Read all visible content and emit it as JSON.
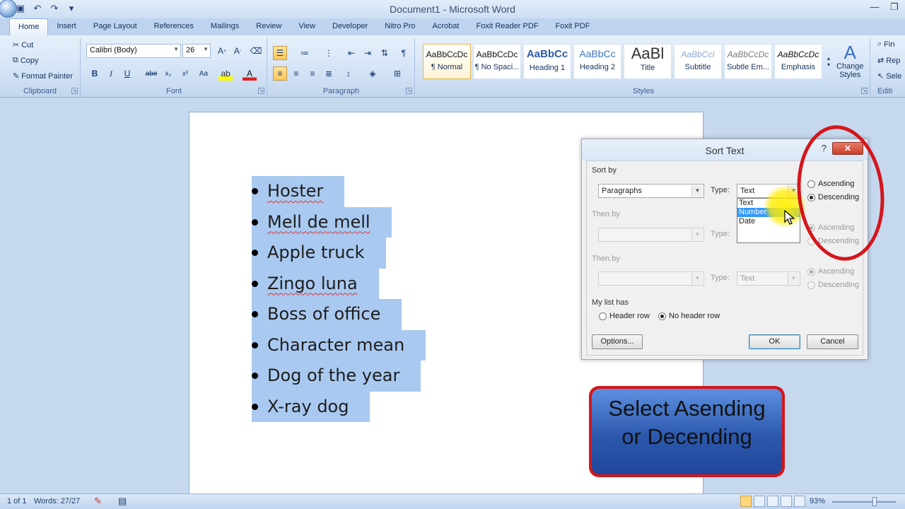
{
  "window": {
    "title": "Document1 - Microsoft Word"
  },
  "tabs": [
    "Home",
    "Insert",
    "Page Layout",
    "References",
    "Mailings",
    "Review",
    "View",
    "Developer",
    "Nitro Pro",
    "Acrobat",
    "Foxit Reader PDF",
    "Foxit PDF"
  ],
  "ribbon": {
    "clipboard": {
      "label": "Clipboard",
      "cut": "Cut",
      "copy": "Copy",
      "format_painter": "Format Painter"
    },
    "font": {
      "label": "Font",
      "font_name": "Calibri (Body)",
      "font_size": "26"
    },
    "paragraph": {
      "label": "Paragraph"
    },
    "styles": {
      "label": "Styles",
      "items": [
        {
          "preview": "AaBbCcDc",
          "name": "¶ Normal"
        },
        {
          "preview": "AaBbCcDc",
          "name": "¶ No Spaci..."
        },
        {
          "preview": "AaBbCc",
          "name": "Heading 1"
        },
        {
          "preview": "AaBbCc",
          "name": "Heading 2"
        },
        {
          "preview": "AaBl",
          "name": "Title"
        },
        {
          "preview": "AaBbCcI",
          "name": "Subtitle"
        },
        {
          "preview": "AaBbCcDc",
          "name": "Subtle Em..."
        },
        {
          "preview": "AaBbCcDc",
          "name": "Emphasis"
        }
      ],
      "change_styles_1": "Change",
      "change_styles_2": "Styles"
    },
    "editing": {
      "label": "Editi",
      "find": "Fin",
      "replace": "Rep",
      "select": "Sele"
    }
  },
  "document": {
    "bullets": [
      "Hoster",
      "Mell de mell",
      "Apple truck",
      "Zingo luna",
      "Boss of office",
      "Character mean",
      "Dog of the year",
      "X-ray dog"
    ]
  },
  "dialog": {
    "title": "Sort Text",
    "help": "?",
    "close": "✕",
    "sort_by_label": "Sort by",
    "sort_by_value": "Paragraphs",
    "type_label": "Type:",
    "type_value": "Text",
    "type_options": [
      "Text",
      "Number",
      "Date"
    ],
    "ascending": "Ascending",
    "descending": "Descending",
    "then_by_label": "Then by",
    "then_by2_type_value": "Text",
    "my_list_has": "My list has",
    "header_row": "Header row",
    "no_header_row": "No header row",
    "options_button": "Options...",
    "ok_button": "OK",
    "cancel_button": "Cancel"
  },
  "annotation": {
    "line1": "Select Asending",
    "line2": "or Decending"
  },
  "status": {
    "page": "1 of 1",
    "words": "Words: 27/27",
    "zoom": "93%"
  },
  "colors": {
    "annotation_red": "#d4161b",
    "selection_blue": "#a9c9f0",
    "highlight_yellow": "#fff000"
  }
}
